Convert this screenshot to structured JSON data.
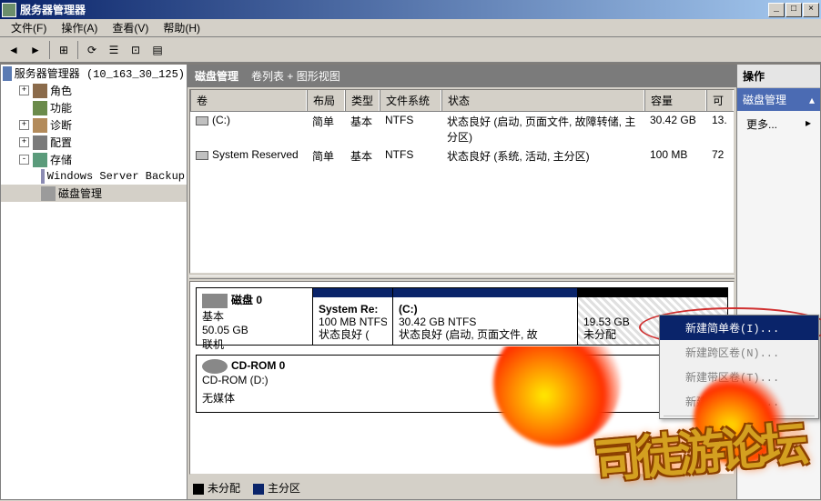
{
  "window": {
    "title": "服务器管理器"
  },
  "titlebar_buttons": {
    "min": "_",
    "max": "□",
    "close": "×"
  },
  "menu": {
    "file": "文件(F)",
    "action": "操作(A)",
    "view": "查看(V)",
    "help": "帮助(H)"
  },
  "tree": {
    "root": "服务器管理器 (10_163_30_125)",
    "roles": "角色",
    "features": "功能",
    "diagnostics": "诊断",
    "configuration": "配置",
    "storage": "存储",
    "backup": "Windows Server Backup",
    "diskmgmt": "磁盘管理"
  },
  "content_header": {
    "title": "磁盘管理",
    "subtitle": "卷列表 + 图形视图"
  },
  "columns": {
    "volume": "卷",
    "layout": "布局",
    "type": "类型",
    "fs": "文件系统",
    "status": "状态",
    "capacity": "容量",
    "free": "可"
  },
  "volumes": [
    {
      "name": "(C:)",
      "layout": "简单",
      "type": "基本",
      "fs": "NTFS",
      "status": "状态良好 (启动, 页面文件, 故障转储, 主分区)",
      "capacity": "30.42 GB",
      "free": "13."
    },
    {
      "name": "System Reserved",
      "layout": "简单",
      "type": "基本",
      "fs": "NTFS",
      "status": "状态良好 (系统, 活动, 主分区)",
      "capacity": "100 MB",
      "free": "72"
    }
  ],
  "disks": {
    "disk0": {
      "name": "磁盘 0",
      "type": "基本",
      "size": "50.05 GB",
      "status": "联机",
      "partitions": {
        "p0": {
          "title": "System Re:",
          "size": "100 MB NTFS",
          "status": "状态良好 ("
        },
        "p1": {
          "title": "(C:)",
          "size": "30.42 GB NTFS",
          "status": "状态良好 (启动, 页面文件, 故"
        },
        "p2": {
          "size": "19.53 GB",
          "status": "未分配"
        }
      }
    },
    "cdrom": {
      "name": "CD-ROM 0",
      "device": "CD-ROM (D:)",
      "status": "无媒体"
    }
  },
  "legend": {
    "unallocated": "未分配",
    "primary": "主分区"
  },
  "actions": {
    "header": "操作",
    "group": "磁盘管理",
    "more": "更多..."
  },
  "context_menu": {
    "simple": "新建简单卷(I)...",
    "spanned": "新建跨区卷(N)...",
    "striped": "新建带区卷(T)...",
    "mirrored": "新建镜像卷(R)..."
  },
  "watermark": "司徒游论坛"
}
